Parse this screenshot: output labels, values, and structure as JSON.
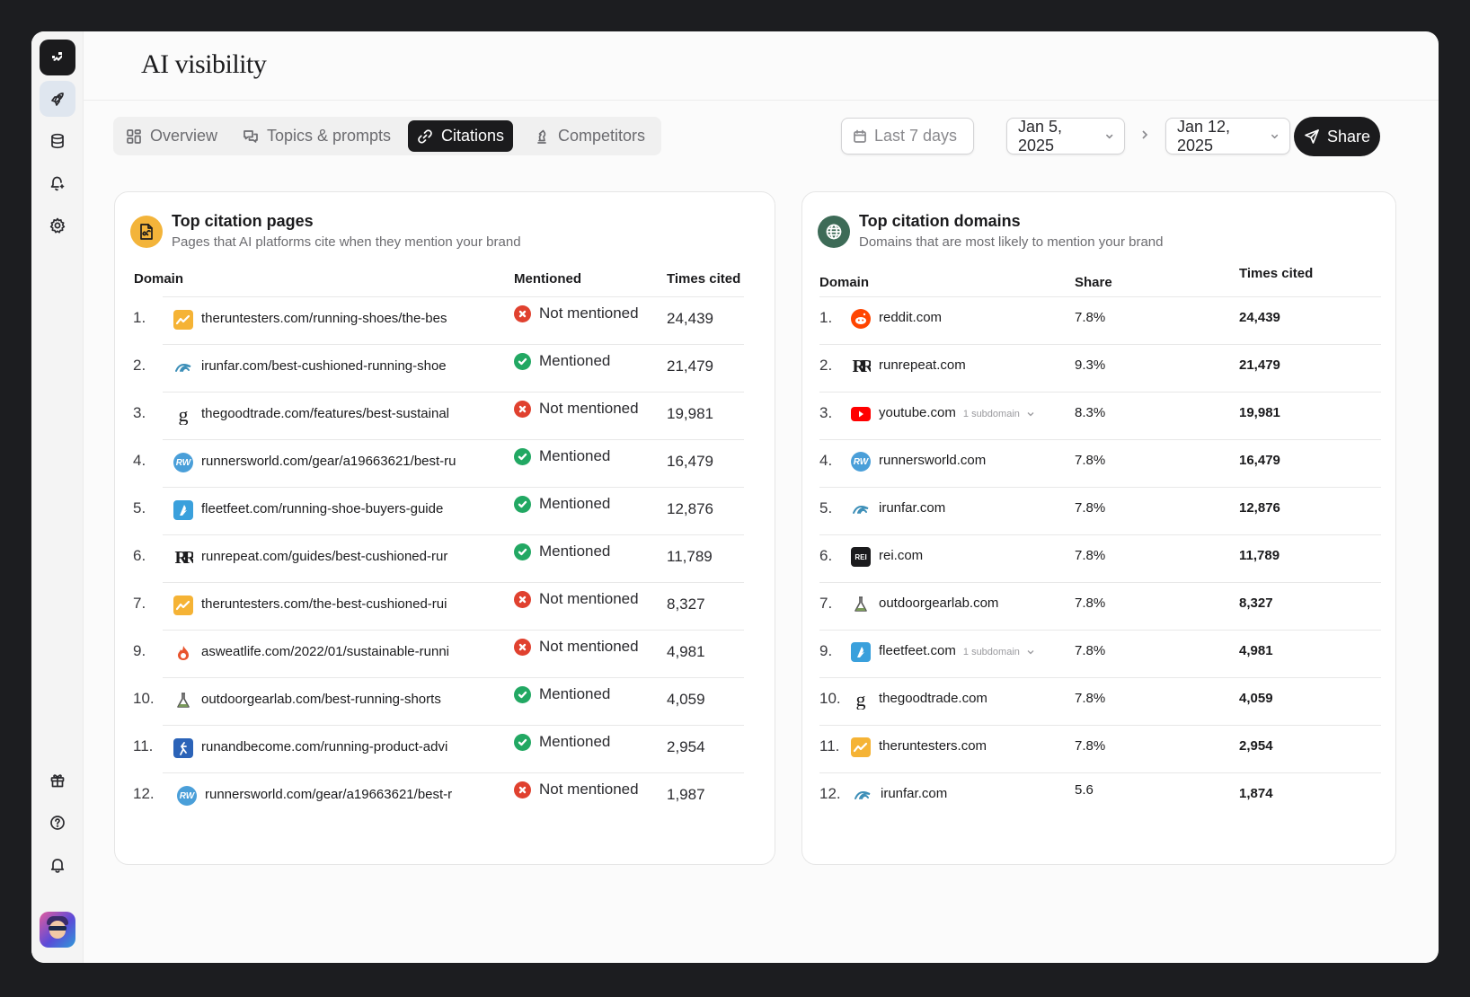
{
  "page": {
    "title": "AI visibility"
  },
  "sidebar": {
    "icons": [
      "logo-icon",
      "rocket-icon",
      "database-icon",
      "chat-bell-icon",
      "gear-icon",
      "gift-icon",
      "help-icon",
      "bell-icon"
    ]
  },
  "tabs": [
    {
      "label": "Overview",
      "icon": "grid-icon",
      "active": false
    },
    {
      "label": "Topics & prompts",
      "icon": "chat-icon",
      "active": false
    },
    {
      "label": "Citations",
      "icon": "link-icon",
      "active": true
    },
    {
      "label": "Competitors",
      "icon": "chess-icon",
      "active": false
    }
  ],
  "controls": {
    "range_label": "Last 7 days",
    "start_date": "Jan 5, 2025",
    "end_date": "Jan 12, 2025",
    "share_label": "Share"
  },
  "pages_card": {
    "title": "Top citation pages",
    "subtitle": "Pages that AI platforms cite when they mention your brand",
    "columns": {
      "domain": "Domain",
      "mentioned": "Mentioned",
      "times_cited": "Times cited"
    },
    "rows": [
      {
        "rank": "1.",
        "url": "theruntesters.com/running-shoes/the-bes",
        "status": "Not mentioned",
        "mentioned": false,
        "cited": "24,439",
        "favicon": "theruntesters"
      },
      {
        "rank": "2.",
        "url": "irunfar.com/best-cushioned-running-shoe",
        "status": "Mentioned",
        "mentioned": true,
        "cited": "21,479",
        "favicon": "irunfar"
      },
      {
        "rank": "3.",
        "url": "thegoodtrade.com/features/best-sustainal",
        "status": "Not mentioned",
        "mentioned": false,
        "cited": "19,981",
        "favicon": "thegoodtrade"
      },
      {
        "rank": "4.",
        "url": "runnersworld.com/gear/a19663621/best-ru",
        "status": "Mentioned",
        "mentioned": true,
        "cited": "16,479",
        "favicon": "runnersworld"
      },
      {
        "rank": "5.",
        "url": "fleetfeet.com/running-shoe-buyers-guide",
        "status": "Mentioned",
        "mentioned": true,
        "cited": "12,876",
        "favicon": "fleetfeet"
      },
      {
        "rank": "6.",
        "url": "runrepeat.com/guides/best-cushioned-rur",
        "status": "Mentioned",
        "mentioned": true,
        "cited": "11,789",
        "favicon": "runrepeat"
      },
      {
        "rank": "7.",
        "url": "theruntesters.com/the-best-cushioned-rui",
        "status": "Not mentioned",
        "mentioned": false,
        "cited": "8,327",
        "favicon": "theruntesters"
      },
      {
        "rank": "9.",
        "url": "asweatlife.com/2022/01/sustainable-runni",
        "status": "Not mentioned",
        "mentioned": false,
        "cited": "4,981",
        "favicon": "asweatlife"
      },
      {
        "rank": "10.",
        "url": "outdoorgearlab.com/best-running-shorts",
        "status": "Mentioned",
        "mentioned": true,
        "cited": "4,059",
        "favicon": "outdoorgearlab"
      },
      {
        "rank": "11.",
        "url": "runandbecome.com/running-product-advi",
        "status": "Mentioned",
        "mentioned": true,
        "cited": "2,954",
        "favicon": "runandbecome"
      },
      {
        "rank": "12.",
        "url": "runnersworld.com/gear/a19663621/best-r",
        "status": "Not mentioned",
        "mentioned": false,
        "cited": "1,987",
        "favicon": "runnersworld"
      }
    ]
  },
  "domains_card": {
    "title": "Top citation domains",
    "subtitle": "Domains that are most likely to mention your brand",
    "columns": {
      "domain": "Domain",
      "share": "Share",
      "times_cited": "Times cited"
    },
    "rows": [
      {
        "rank": "1.",
        "domain": "reddit.com",
        "subdomain": "",
        "share": "7.8%",
        "cited": "24,439",
        "favicon": "reddit"
      },
      {
        "rank": "2.",
        "domain": "runrepeat.com",
        "subdomain": "",
        "share": "9.3%",
        "cited": "21,479",
        "favicon": "runrepeat"
      },
      {
        "rank": "3.",
        "domain": "youtube.com",
        "subdomain": "1 subdomain",
        "share": "8.3%",
        "cited": "19,981",
        "favicon": "youtube"
      },
      {
        "rank": "4.",
        "domain": "runnersworld.com",
        "subdomain": "",
        "share": "7.8%",
        "cited": "16,479",
        "favicon": "runnersworld"
      },
      {
        "rank": "5.",
        "domain": "irunfar.com",
        "subdomain": "",
        "share": "7.8%",
        "cited": "12,876",
        "favicon": "irunfar"
      },
      {
        "rank": "6.",
        "domain": "rei.com",
        "subdomain": "",
        "share": "7.8%",
        "cited": "11,789",
        "favicon": "rei"
      },
      {
        "rank": "7.",
        "domain": "outdoorgearlab.com",
        "subdomain": "",
        "share": "7.8%",
        "cited": "8,327",
        "favicon": "outdoorgearlab"
      },
      {
        "rank": "9.",
        "domain": "fleetfeet.com",
        "subdomain": "1 subdomain",
        "share": "7.8%",
        "cited": "4,981",
        "favicon": "fleetfeet"
      },
      {
        "rank": "10.",
        "domain": "thegoodtrade.com",
        "subdomain": "",
        "share": "7.8%",
        "cited": "4,059",
        "favicon": "thegoodtrade"
      },
      {
        "rank": "11.",
        "domain": "theruntesters.com",
        "subdomain": "",
        "share": "7.8%",
        "cited": "2,954",
        "favicon": "theruntesters"
      },
      {
        "rank": "12.",
        "domain": "irunfar.com",
        "subdomain": "",
        "share": "5.6",
        "cited": "1,874",
        "favicon": "irunfar"
      }
    ]
  },
  "colors": {
    "accent_dark": "#1b1b1d",
    "mentioned_green": "#22a863",
    "not_mentioned_red": "#e0412f",
    "pages_icon_bg": "#f3b43a",
    "domains_icon_bg": "#3d6b57"
  }
}
